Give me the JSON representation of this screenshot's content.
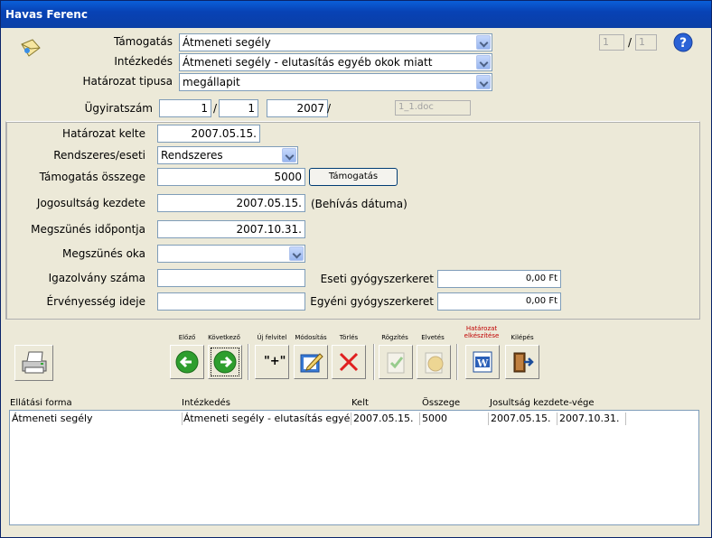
{
  "window": {
    "title": "Havas Ferenc"
  },
  "header": {
    "tamogatas_label": "Támogatás",
    "tamogatas_value": "Átmeneti segély",
    "intezkedes_label": "Intézkedés",
    "intezkedes_value": "Átmeneti segély - elutasítás egyéb okok miatt",
    "hatarozat_tipus_label": "Határozat tipusa",
    "hatarozat_tipus_value": "megállapit",
    "page_current": "1",
    "page_sep": "/",
    "page_total": "1",
    "ugyiratszam_label": "Ügyiratszám",
    "ugyirat_1": "1",
    "ugyirat_sep1": "/",
    "ugyirat_2": "1",
    "ugyirat_3": "2007",
    "ugyirat_sep2": "/",
    "doc_file": "1_1.doc"
  },
  "form": {
    "hatarozat_kelte_label": "Határozat kelte",
    "hatarozat_kelte": "2007.05.15.",
    "rendszeres_label": "Rendszeres/eseti",
    "rendszeres_value": "Rendszeres",
    "osszeg_label": "Támogatás összege",
    "osszeg_value": "5000",
    "tamogatas_button": "Támogatás",
    "jogosultsag_label": "Jogosultság kezdete",
    "jogosultsag_value": "2007.05.15.",
    "behivas_note": "(Behívás dátuma)",
    "megszunes_label": "Megszünés időpontja",
    "megszunes_value": "2007.10.31.",
    "megszunes_oka_label": "Megszünés oka",
    "megszunes_oka_value": "",
    "igazolvany_label": "Igazolvány száma",
    "igazolvany_value": "",
    "ervenyesseg_label": "Érvényesség ideje",
    "ervenyesseg_value": "",
    "eseti_label": "Eseti gyógyszerkeret",
    "eseti_value": "0,00 Ft",
    "egyeni_label": "Egyéni gyógyszerkeret",
    "egyeni_value": "0,00 Ft"
  },
  "toolbar": {
    "elozo": "Előző",
    "kovetkezo": "Következő",
    "uj_felvitel": "Új felvitel",
    "uj_icon_text": "\"+\"",
    "modositas": "Módosítás",
    "torles": "Törlés",
    "rogzites": "Rögzítés",
    "elvetes": "Elvetés",
    "hatarozat_line1": "Határozat",
    "hatarozat_line2": "elkészítése",
    "hatarozat_color": "#c00000",
    "kilepes": "Kilépés",
    "word_letter": "W"
  },
  "table": {
    "headers": [
      "Ellátási forma",
      "Intézkedés",
      "Kelt",
      "Összege",
      "Josultság kezdete-vége"
    ],
    "rows": [
      [
        "Átmeneti segély",
        "Átmeneti segély - elutasítás egyéb okok miatt",
        "2007.05.15.",
        "5000",
        "2007.05.15.",
        "2007.10.31."
      ]
    ]
  },
  "icons": [
    "envelope-icon",
    "help-icon",
    "printer-icon",
    "arrow-left-icon",
    "arrow-right-icon",
    "new-record-icon",
    "edit-icon",
    "delete-icon",
    "save-icon",
    "discard-icon",
    "word-icon",
    "exit-door-icon"
  ]
}
